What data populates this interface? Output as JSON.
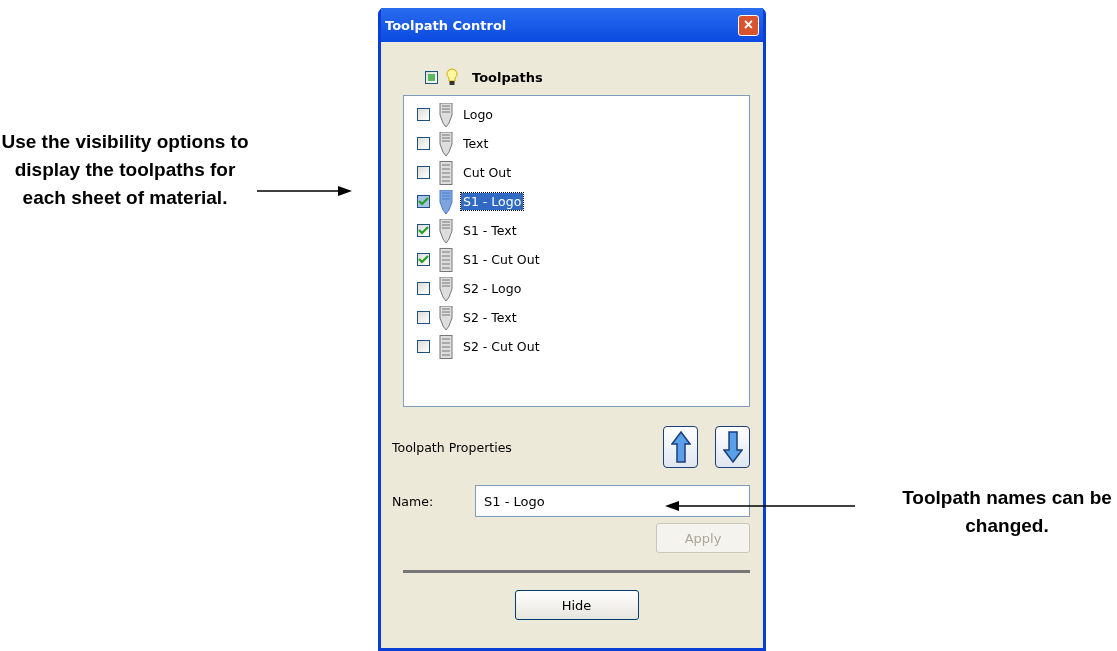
{
  "left_note": "Use the visibility options to display the toolpaths for each sheet of material.",
  "right_note": "Toolpath names can be changed.",
  "window": {
    "title": "Toolpath Control",
    "close": "×"
  },
  "header": {
    "label": "Toolpaths",
    "mixed": true
  },
  "toolpaths": [
    {
      "name": "Logo",
      "kind": "tapered",
      "checked": false,
      "selected": false
    },
    {
      "name": "Text",
      "kind": "tapered",
      "checked": false,
      "selected": false
    },
    {
      "name": "Cut Out",
      "kind": "straight",
      "checked": false,
      "selected": false
    },
    {
      "name": "S1 - Logo",
      "kind": "tapered",
      "checked": true,
      "selected": true
    },
    {
      "name": "S1 - Text",
      "kind": "tapered",
      "checked": true,
      "selected": false
    },
    {
      "name": "S1 - Cut Out",
      "kind": "straight",
      "checked": true,
      "selected": false
    },
    {
      "name": "S2 - Logo",
      "kind": "tapered",
      "checked": false,
      "selected": false
    },
    {
      "name": "S2 - Text",
      "kind": "tapered",
      "checked": false,
      "selected": false
    },
    {
      "name": "S2 - Cut Out",
      "kind": "straight",
      "checked": false,
      "selected": false
    }
  ],
  "properties": {
    "label": "Toolpath Properties",
    "name_label": "Name:",
    "name_value": "S1 - Logo",
    "apply": {
      "label": "Apply",
      "disabled": true
    }
  },
  "hide_button": "Hide"
}
